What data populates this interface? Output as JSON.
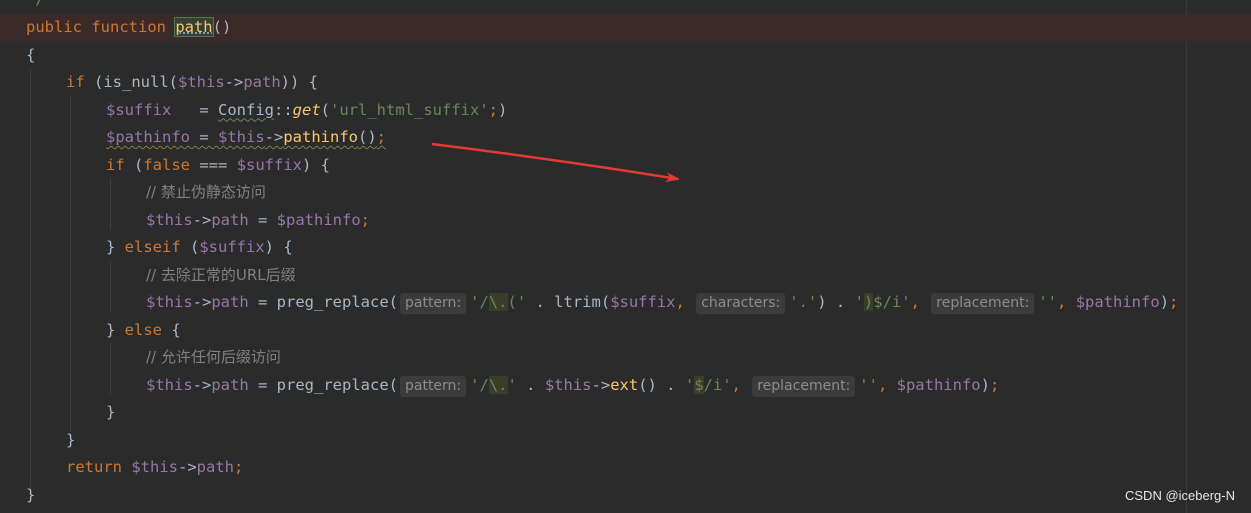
{
  "editor": {
    "doc_comment_tail": " */",
    "watermark": "CSDN @iceberg-N",
    "lines": [
      {
        "tokens": [
          [
            "kw",
            "public function "
          ],
          [
            "sel",
            "path"
          ],
          [
            "p",
            "()"
          ]
        ]
      },
      {
        "tokens": [
          [
            "p",
            "{"
          ]
        ]
      },
      {
        "tokens": [
          [
            "kw",
            "if "
          ],
          [
            "p",
            "(is_null("
          ],
          [
            "var",
            "$this"
          ],
          [
            "p",
            "->"
          ],
          [
            "var",
            "path"
          ],
          [
            "p",
            ")) {"
          ]
        ]
      },
      {
        "tokens": [
          [
            "var",
            "$suffix"
          ],
          [
            "p",
            "   = "
          ],
          [
            "cls",
            "Config"
          ],
          [
            "p",
            "::"
          ],
          [
            "it",
            "get"
          ],
          [
            "p",
            "("
          ],
          [
            "str",
            "'url_html_suffix'"
          ],
          [
            "kw",
            ";"
          ],
          [
            "p",
            ")"
          ]
        ]
      },
      {
        "tokens": [
          [
            "var",
            "$pathinfo"
          ],
          [
            "p",
            " = "
          ],
          [
            "var",
            "$this"
          ],
          [
            "p",
            "->"
          ],
          [
            "fn",
            "pathinfo"
          ],
          [
            "p",
            "()"
          ],
          [
            "kw",
            ";"
          ]
        ]
      },
      {
        "tokens": [
          [
            "kw",
            "if "
          ],
          [
            "p",
            "("
          ],
          [
            "kw",
            "false"
          ],
          [
            "p",
            " === "
          ],
          [
            "var",
            "$suffix"
          ],
          [
            "p",
            ") {"
          ]
        ]
      },
      {
        "tokens": [
          [
            "cmt",
            "// 禁止伪静态访问"
          ]
        ]
      },
      {
        "tokens": [
          [
            "var",
            "$this"
          ],
          [
            "p",
            "->"
          ],
          [
            "var",
            "path"
          ],
          [
            "p",
            " = "
          ],
          [
            "var",
            "$pathinfo"
          ],
          [
            "kw",
            ";"
          ]
        ]
      },
      {
        "tokens": [
          [
            "p",
            "} "
          ],
          [
            "kw",
            "elseif "
          ],
          [
            "p",
            "("
          ],
          [
            "var",
            "$suffix"
          ],
          [
            "p",
            ") {"
          ]
        ]
      },
      {
        "tokens": [
          [
            "cmt",
            "// 去除正常的URL后缀"
          ]
        ]
      },
      {
        "tokens": [
          [
            "var",
            "$this"
          ],
          [
            "p",
            "->"
          ],
          [
            "var",
            "path"
          ],
          [
            "p",
            " = preg_replace("
          ],
          [
            "hint",
            "pattern:"
          ],
          [
            "str",
            "'/"
          ],
          [
            "re",
            "\\."
          ],
          [
            "str",
            "("
          ],
          [
            "str",
            "'"
          ],
          [
            "p",
            " . ltrim("
          ],
          [
            "var",
            "$suffix"
          ],
          [
            "kw",
            ", "
          ],
          [
            "hint",
            "characters:"
          ],
          [
            "str",
            "'.'"
          ],
          [
            "p",
            ") . "
          ],
          [
            "str",
            "'"
          ],
          [
            "re",
            ")"
          ],
          [
            "dollar",
            "$"
          ],
          [
            "str",
            "/i'"
          ],
          [
            "kw",
            ", "
          ],
          [
            "hint",
            "replacement:"
          ],
          [
            "str",
            "''"
          ],
          [
            "kw",
            ", "
          ],
          [
            "var",
            "$pathinfo"
          ],
          [
            "p",
            ")"
          ],
          [
            "kw",
            ";"
          ]
        ]
      },
      {
        "tokens": [
          [
            "p",
            "} "
          ],
          [
            "kw",
            "else "
          ],
          [
            "p",
            "{"
          ]
        ]
      },
      {
        "tokens": [
          [
            "cmt",
            "// 允许任何后缀访问"
          ]
        ]
      },
      {
        "tokens": [
          [
            "var",
            "$this"
          ],
          [
            "p",
            "->"
          ],
          [
            "var",
            "path"
          ],
          [
            "p",
            " = preg_replace("
          ],
          [
            "hint",
            "pattern:"
          ],
          [
            "str",
            "'/"
          ],
          [
            "re",
            "\\."
          ],
          [
            "str",
            "'"
          ],
          [
            "p",
            " . "
          ],
          [
            "var",
            "$this"
          ],
          [
            "p",
            "->"
          ],
          [
            "fn",
            "ext"
          ],
          [
            "p",
            "() . "
          ],
          [
            "str",
            "'"
          ],
          [
            "re",
            "$"
          ],
          [
            "str",
            "/i'"
          ],
          [
            "kw",
            ", "
          ],
          [
            "hint",
            "replacement:"
          ],
          [
            "str",
            "''"
          ],
          [
            "kw",
            ", "
          ],
          [
            "var",
            "$pathinfo"
          ],
          [
            "p",
            ")"
          ],
          [
            "kw",
            ";"
          ]
        ]
      },
      {
        "tokens": [
          [
            "p",
            "}"
          ]
        ]
      },
      {
        "tokens": [
          [
            "p",
            "}"
          ]
        ]
      },
      {
        "tokens": [
          [
            "kw",
            "return "
          ],
          [
            "var",
            "$this"
          ],
          [
            "p",
            "->"
          ],
          [
            "var",
            "path"
          ],
          [
            "kw",
            ";"
          ]
        ]
      },
      {
        "tokens": [
          [
            "p",
            "}"
          ]
        ]
      }
    ],
    "colors": {
      "background": "#2b2b2b",
      "keyword": "#cc7832",
      "variable": "#9876aa",
      "function": "#ffc66d",
      "string": "#6a8759",
      "comment": "#808080",
      "annotation_arrow": "#e53935"
    }
  }
}
